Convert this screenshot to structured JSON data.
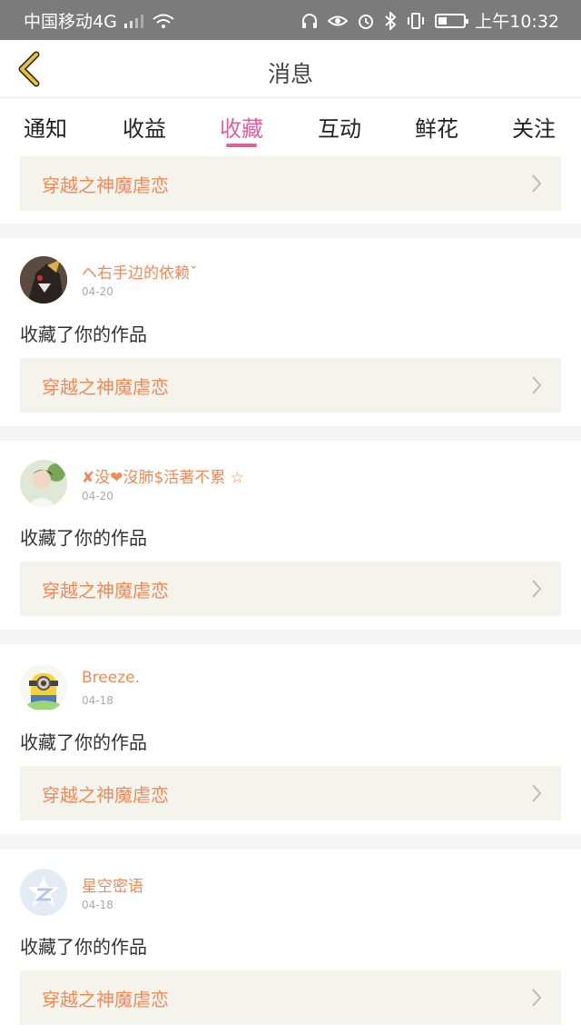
{
  "status_bar": {
    "carrier": "中国移动4G",
    "network_badge": "4G",
    "time": "上午10:32",
    "icons": [
      "signal-icon",
      "wifi-icon",
      "headset-icon",
      "eye-icon",
      "alarm-icon",
      "bluetooth-icon",
      "vibrate-icon",
      "battery-icon"
    ]
  },
  "nav": {
    "title": "消息",
    "back_icon": "chevron-left-icon"
  },
  "tabs": [
    {
      "label": "通知",
      "active": false
    },
    {
      "label": "收益",
      "active": false
    },
    {
      "label": "收藏",
      "active": true
    },
    {
      "label": "互动",
      "active": false
    },
    {
      "label": "鲜花",
      "active": false
    },
    {
      "label": "关注",
      "active": false
    }
  ],
  "top_item": {
    "work_title": "穿越之神魔虐恋"
  },
  "items": [
    {
      "user": "ヘ右手边的依赖ˇ",
      "date": "04-20",
      "action": "收藏了你的作品",
      "work_title": "穿越之神魔虐恋",
      "avatar": "avatar-dark"
    },
    {
      "user": "✘没❤沒肺$活著不累 ☆",
      "date": "04-20",
      "action": "收藏了你的作品",
      "work_title": "穿越之神魔虐恋",
      "avatar": "avatar-photo"
    },
    {
      "user": "Breeze.",
      "date": "04-18",
      "action": "收藏了你的作品",
      "work_title": "穿越之神魔虐恋",
      "avatar": "avatar-minion"
    },
    {
      "user": "星空密语",
      "date": "04-18",
      "action": "收藏了你的作品",
      "work_title": "穿越之神魔虐恋",
      "avatar": "avatar-default"
    }
  ],
  "colors": {
    "accent": "#e0609c",
    "link_text": "#ee8a5a",
    "card_bg": "#f4f3ec",
    "back_icon": "#e8c23a"
  }
}
